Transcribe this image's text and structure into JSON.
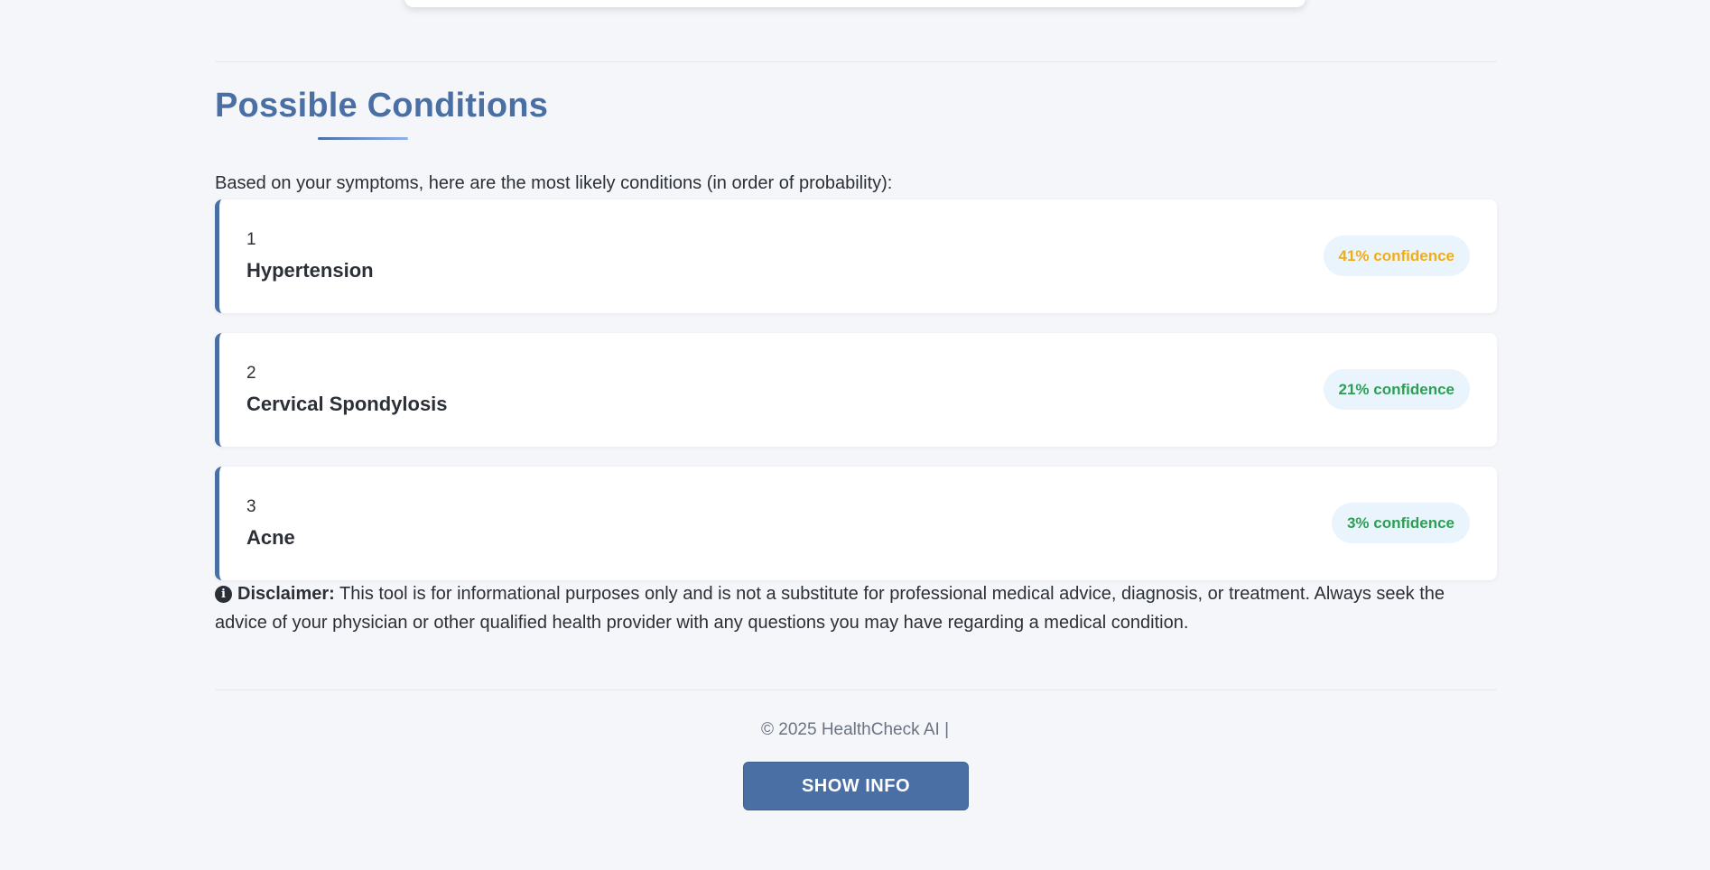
{
  "conditions_section": {
    "title": "Possible Conditions",
    "intro": "Based on your symptoms, here are the most likely conditions (in order of probability):",
    "conditions": [
      {
        "rank": "1",
        "name": "Hypertension",
        "confidence_label": "41% confidence",
        "confidence_percent": 41,
        "confidence_color": "#f0ad1a"
      },
      {
        "rank": "2",
        "name": "Cervical Spondylosis",
        "confidence_label": "21% confidence",
        "confidence_percent": 21,
        "confidence_color": "#2e9e55"
      },
      {
        "rank": "3",
        "name": "Acne",
        "confidence_label": "3% confidence",
        "confidence_percent": 3,
        "confidence_color": "#2e9e55"
      }
    ]
  },
  "disclaimer": {
    "icon": "info-circle-icon",
    "label": "Disclaimer:",
    "text": " This tool is for informational purposes only and is not a substitute for professional medical advice, diagnosis, or treatment. Always seek the advice of your physician or other qualified health provider with any questions you may have regarding a medical condition."
  },
  "footer": {
    "copyright": "© 2025 HealthCheck AI |",
    "button_label": "SHOW INFO"
  },
  "colors": {
    "accent": "#4a6fa5",
    "background": "#f4f6fa",
    "badge_background": "#eaf4fd"
  }
}
